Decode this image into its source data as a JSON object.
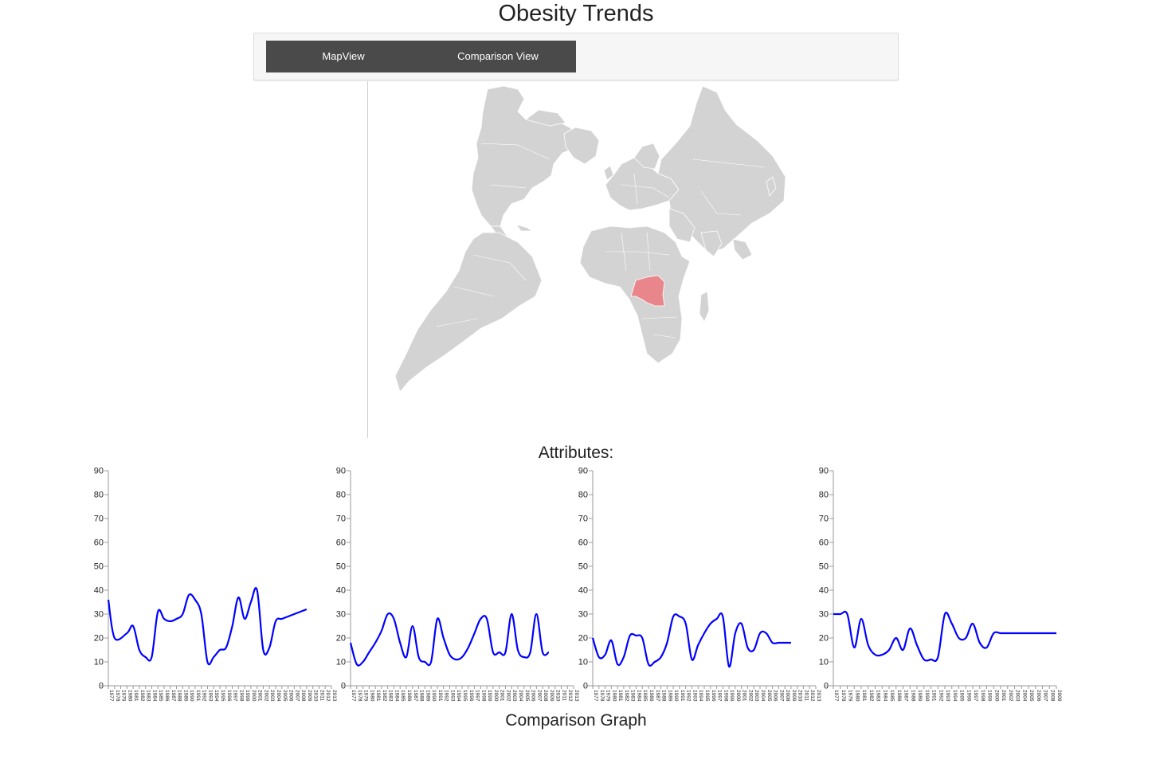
{
  "page": {
    "title": "Obesity Trends"
  },
  "nav": {
    "tabs": [
      {
        "label": "MapView"
      },
      {
        "label": "Comparison View"
      }
    ]
  },
  "map": {
    "base_color": "#d3d3d3",
    "border_color": "#ffffff",
    "highlight_color": "#e8868b",
    "highlighted_region": "Democratic Republic of the Congo"
  },
  "sections": {
    "attributes_label": "Attributes:",
    "comparison_label": "Comparison Graph"
  },
  "chart_data": [
    {
      "type": "line",
      "line_color": "#0000ff",
      "ylim": [
        0,
        90
      ],
      "y_ticks": [
        0,
        10,
        20,
        30,
        40,
        50,
        60,
        70,
        80,
        90
      ],
      "x_ticks": [
        1977,
        1978,
        1979,
        1980,
        1981,
        1982,
        1983,
        1984,
        1985,
        1986,
        1987,
        1988,
        1989,
        1990,
        1991,
        1992,
        1993,
        1994,
        1995,
        1996,
        1997,
        1998,
        1999,
        2000,
        2001,
        2002,
        2003,
        2004,
        2005,
        2006,
        2007,
        2008,
        2009,
        2010,
        2011,
        2012,
        2013
      ],
      "x": [
        1977,
        1978,
        1980,
        1981,
        1982,
        1983,
        1984,
        1985,
        1986,
        1987,
        1988,
        1989,
        1990,
        1991,
        1992,
        1993,
        1994,
        1995,
        1996,
        1997,
        1998,
        1999,
        2000,
        2001,
        2002,
        2003,
        2004,
        2005,
        2006,
        2007,
        2008,
        2009
      ],
      "values": [
        36,
        20,
        22,
        25,
        15,
        12,
        12,
        31,
        28,
        27,
        28,
        30,
        38,
        36,
        30,
        10,
        12,
        15,
        16,
        25,
        37,
        28,
        35,
        40,
        15,
        16,
        27,
        28,
        29,
        30,
        31,
        32
      ]
    },
    {
      "type": "line",
      "line_color": "#0000ff",
      "ylim": [
        0,
        90
      ],
      "y_ticks": [
        0,
        10,
        20,
        30,
        40,
        50,
        60,
        70,
        80,
        90
      ],
      "x_ticks": [
        1977,
        1978,
        1979,
        1980,
        1981,
        1982,
        1983,
        1984,
        1985,
        1986,
        1987,
        1988,
        1989,
        1990,
        1991,
        1992,
        1993,
        1994,
        1995,
        1996,
        1997,
        1998,
        1999,
        2000,
        2001,
        2002,
        2003,
        2004,
        2005,
        2006,
        2007,
        2008,
        2009,
        2010,
        2011,
        2012,
        2013
      ],
      "x": [
        1977,
        1978,
        1979,
        1980,
        1981,
        1982,
        1983,
        1984,
        1985,
        1986,
        1987,
        1988,
        1989,
        1990,
        1991,
        1992,
        1993,
        1994,
        1995,
        1996,
        1997,
        1998,
        1999,
        2000,
        2001,
        2002,
        2003,
        2004,
        2005,
        2006,
        2007,
        2008,
        2009
      ],
      "values": [
        18,
        9,
        10,
        14,
        18,
        23,
        30,
        28,
        18,
        12,
        25,
        12,
        10,
        10,
        28,
        20,
        13,
        11,
        12,
        16,
        22,
        28,
        28,
        14,
        14,
        14,
        30,
        15,
        12,
        14,
        30,
        14,
        14
      ]
    },
    {
      "type": "line",
      "line_color": "#0000ff",
      "ylim": [
        0,
        90
      ],
      "y_ticks": [
        0,
        10,
        20,
        30,
        40,
        50,
        60,
        70,
        80,
        90
      ],
      "x_ticks": [
        1977,
        1978,
        1979,
        1980,
        1981,
        1982,
        1983,
        1984,
        1985,
        1986,
        1987,
        1988,
        1989,
        1990,
        1991,
        1992,
        1993,
        1994,
        1995,
        1996,
        1997,
        1998,
        1999,
        2000,
        2001,
        2002,
        2003,
        2004,
        2005,
        2006,
        2007,
        2008,
        2009,
        2010,
        2011,
        2012,
        2013
      ],
      "x": [
        1977,
        1978,
        1979,
        1980,
        1981,
        1982,
        1983,
        1984,
        1985,
        1986,
        1987,
        1988,
        1989,
        1990,
        1991,
        1992,
        1993,
        1994,
        1995,
        1996,
        1997,
        1998,
        1999,
        2000,
        2001,
        2002,
        2003,
        2004,
        2005,
        2006,
        2007,
        2008,
        2009
      ],
      "values": [
        20,
        12,
        13,
        19,
        9,
        12,
        21,
        21,
        20,
        9,
        10,
        12,
        18,
        29,
        29,
        26,
        11,
        17,
        22,
        26,
        28,
        29,
        8,
        22,
        26,
        16,
        15,
        22,
        22,
        18,
        18,
        18,
        18
      ]
    },
    {
      "type": "line",
      "line_color": "#0000ff",
      "ylim": [
        0,
        90
      ],
      "y_ticks": [
        0,
        10,
        20,
        30,
        40,
        50,
        60,
        70,
        80,
        90
      ],
      "x_ticks": [
        1977,
        1978,
        1979,
        1980,
        1981,
        1982,
        1983,
        1984,
        1985,
        1986,
        1987,
        1988,
        1989,
        1990,
        1991,
        1992,
        1993,
        1994,
        1995,
        1996,
        1997,
        1998,
        1999,
        2000,
        2001,
        2002,
        2003,
        2004,
        2005,
        2006,
        2007,
        2008,
        2009
      ],
      "x": [
        1977,
        1978,
        1979,
        1980,
        1981,
        1982,
        1983,
        1984,
        1985,
        1986,
        1987,
        1988,
        1989,
        1990,
        1991,
        1992,
        1993,
        1994,
        1995,
        1996,
        1997,
        1998,
        1999,
        2000,
        2001,
        2002,
        2003,
        2004,
        2005,
        2006,
        2007,
        2008,
        2009
      ],
      "values": [
        30,
        30,
        30,
        16,
        28,
        17,
        13,
        13,
        15,
        20,
        15,
        24,
        17,
        11,
        11,
        12,
        30,
        26,
        20,
        20,
        26,
        18,
        16,
        22,
        22,
        22,
        22,
        22,
        22,
        22,
        22,
        22,
        22
      ]
    }
  ]
}
